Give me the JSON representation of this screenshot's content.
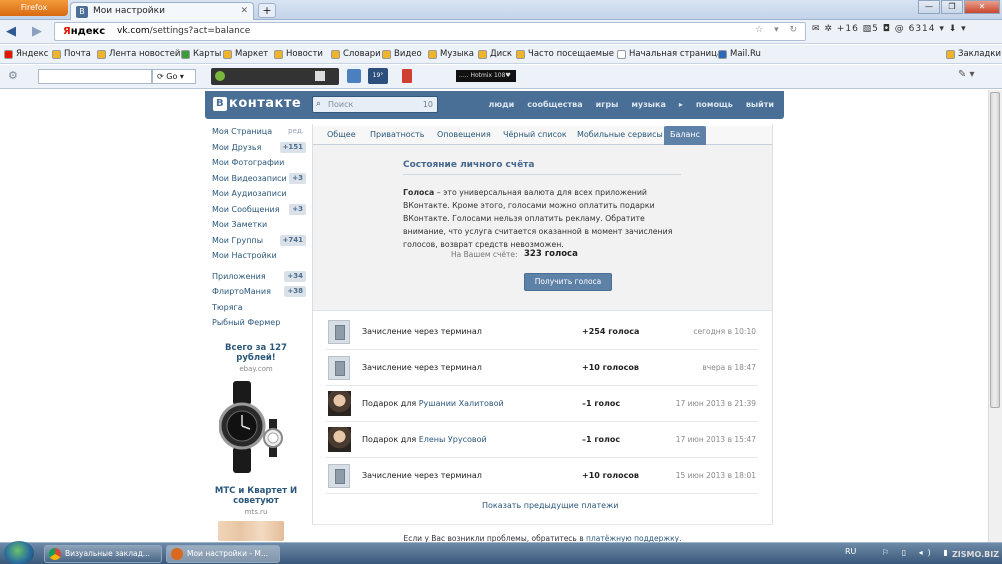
{
  "browser": {
    "menu_label": "Firefox",
    "tab_title": "Мои настройки",
    "new_tab_icon": "+",
    "window_controls": [
      "—",
      "❐",
      "✕"
    ]
  },
  "navbar": {
    "back_icon": "arrow-left-icon",
    "forward_icon": "arrow-right-icon",
    "yandex": "Яндекс",
    "url_host": "vk.com",
    "url_path": "/settings?act=balance",
    "url_icons": "☆ ▾ ↻",
    "right": "✉ ✲ +16  ▧5  ◘  @ 6314 ▾  ⬇ ▾"
  },
  "bookmarks": [
    {
      "label": "Яндекс",
      "color": "#e61400"
    },
    {
      "label": "Почта",
      "color": "#f0b428"
    },
    {
      "label": "Лента новостей",
      "color": "#f0b428"
    },
    {
      "label": "Карты",
      "color": "#3a9c3a"
    },
    {
      "label": "Маркет",
      "color": "#f0b428"
    },
    {
      "label": "Новости",
      "color": "#f0b428"
    },
    {
      "label": "Словари",
      "color": "#f0b428"
    },
    {
      "label": "Видео",
      "color": "#f0b428"
    },
    {
      "label": "Музыка",
      "color": "#f0b428"
    },
    {
      "label": "Диск",
      "color": "#f0b428"
    },
    {
      "label": "Часто посещаемые",
      "color": "#f0b428"
    },
    {
      "label": "Начальная страница",
      "color": "#ffffff"
    },
    {
      "label": "Mail.Ru",
      "color": "#2a6ab6"
    },
    {
      "label": "Закладки",
      "color": "#f0b428"
    }
  ],
  "toolbar3": {
    "go": "Go",
    "track": "..... Hotmix 108♥"
  },
  "vk": {
    "logo": "контакте",
    "logo_b": "В",
    "search_placeholder": "Поиск",
    "search_count": "10",
    "nav": [
      "люди",
      "сообщества",
      "игры",
      "музыка",
      "▸",
      "помощь",
      "выйти"
    ]
  },
  "left_menu": [
    {
      "label": "Моя Страница",
      "extra": "ред."
    },
    {
      "label": "Мои Друзья",
      "badge": "+151"
    },
    {
      "label": "Мои Фотографии"
    },
    {
      "label": "Мои Видеозаписи",
      "badge": "+3"
    },
    {
      "label": "Мои Аудиозаписи"
    },
    {
      "label": "Мои Сообщения",
      "badge": "+3"
    },
    {
      "label": "Мои Заметки"
    },
    {
      "label": "Мои Группы",
      "badge": "+741"
    },
    {
      "label": "Мои Настройки"
    }
  ],
  "left_menu2": [
    {
      "label": "Приложения",
      "badge": "+34"
    },
    {
      "label": "ФлиртоМания",
      "badge": "+38"
    },
    {
      "label": "Тюряга"
    },
    {
      "label": "Рыбный Фермер"
    }
  ],
  "ads": [
    {
      "title": "Всего за 127 рублей!",
      "site": "ebay.com"
    },
    {
      "title": "МТС и Квартет И советуют",
      "site": "mts.ru"
    }
  ],
  "tabs": [
    "Общее",
    "Приватность",
    "Оповещения",
    "Чёрный список",
    "Мобильные сервисы",
    "Баланс"
  ],
  "balance": {
    "title": "Состояние личного счёта",
    "desc_bold": "Голоса",
    "desc": " – это универсальная валюта для всех приложений ВКонтакте. Кроме этого, голосами можно оплатить подарки ВКонтакте. Голосами нельзя оплатить рекламу. Обратите внимание, что услуга считается оказанной в момент зачисления голосов, возврат средств невозможен.",
    "label": "На Вашем счёте:",
    "value": "323 голоса",
    "button": "Получить голоса"
  },
  "transactions": [
    {
      "type": "terminal",
      "desc": "Зачисление через терминал",
      "who": "",
      "amount": "+254 голоса",
      "date": "сегодня в 10:10"
    },
    {
      "type": "terminal",
      "desc": "Зачисление через терминал",
      "who": "",
      "amount": "+10 голосов",
      "date": "вчера в 18:47"
    },
    {
      "type": "gift",
      "desc": "Подарок для ",
      "who": "Рушании Халитовой",
      "amount": "–1 голос",
      "date": "17 июн 2013 в 21:39"
    },
    {
      "type": "gift",
      "desc": "Подарок для ",
      "who": "Елены Урусовой",
      "amount": "–1 голос",
      "date": "17 июн 2013 в 15:47"
    },
    {
      "type": "terminal",
      "desc": "Зачисление через терминал",
      "who": "",
      "amount": "+10 голосов",
      "date": "15 июн 2013 в 18:01"
    }
  ],
  "show_prev": "Показать предыдущие платежи",
  "help": {
    "text": "Если у Вас возникли проблемы, обратитесь в ",
    "link": "платёжную поддержку."
  },
  "taskbar": {
    "tasks": [
      "Визуальные заклад...",
      "Мои настройки - М..."
    ],
    "lang": "RU",
    "tray": "⚐ ▯ ◂) ▮"
  },
  "watermark": "ZISMO.BIZ"
}
